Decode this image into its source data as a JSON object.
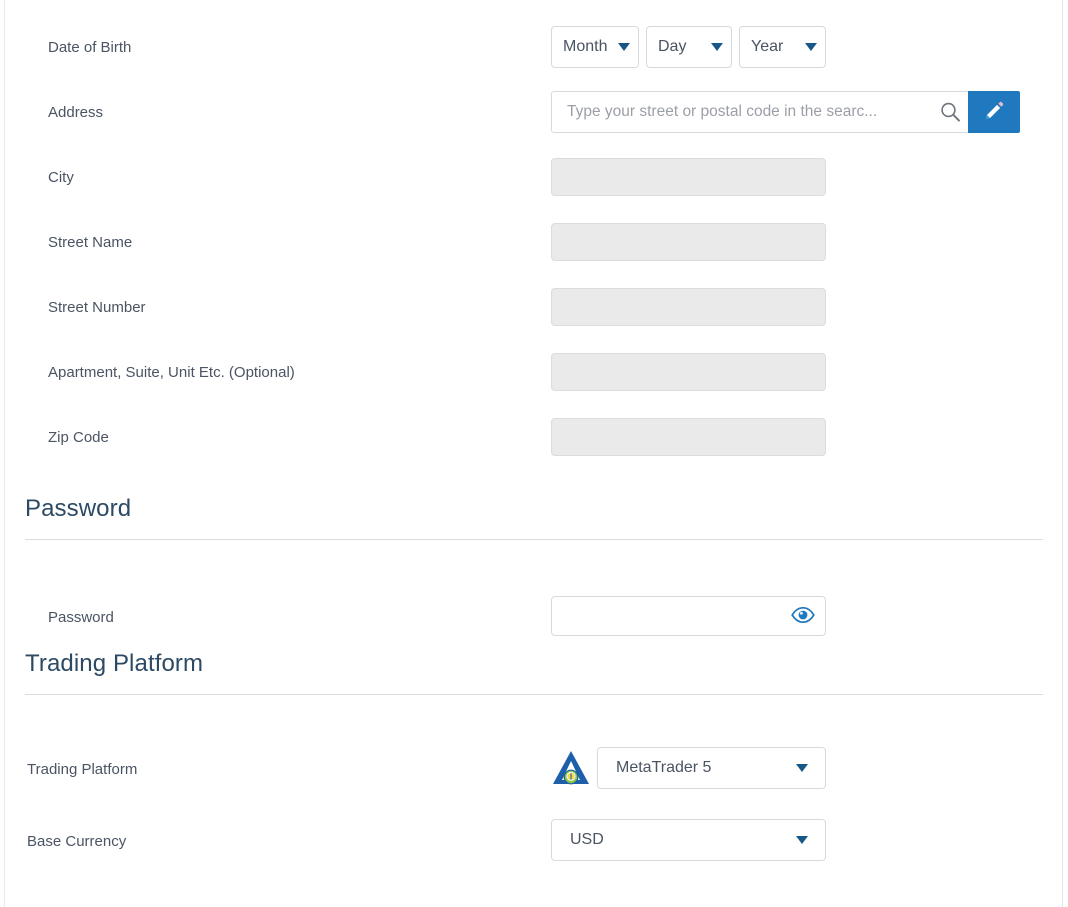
{
  "form": {
    "fields": [
      {
        "label": "Date of Birth",
        "type": "date-selects"
      },
      {
        "label": "Address",
        "type": "address-search"
      },
      {
        "label": "City",
        "type": "disabled-text"
      },
      {
        "label": "Street Name",
        "type": "disabled-text"
      },
      {
        "label": "Street Number",
        "type": "disabled-text"
      },
      {
        "label": "Apartment, Suite, Unit Etc. (Optional)",
        "type": "disabled-text"
      },
      {
        "label": "Zip Code",
        "type": "disabled-text"
      }
    ],
    "date_of_birth": {
      "month": {
        "value": "Month",
        "placeholder": "Month"
      },
      "day": {
        "value": "Day",
        "placeholder": "Day"
      },
      "year": {
        "value": "Year",
        "placeholder": "Year"
      }
    },
    "address": {
      "placeholder": "Type your street or postal code in the searc...",
      "value": "",
      "search_icon": "search-icon",
      "edit_icon": "pencil-icon"
    },
    "city": {
      "value": ""
    },
    "street_name": {
      "value": ""
    },
    "street_number": {
      "value": ""
    },
    "apartment": {
      "value": ""
    },
    "zip_code": {
      "value": ""
    }
  },
  "password_section": {
    "heading": "Password",
    "field_label": "Password",
    "value": "",
    "placeholder": "",
    "toggle_icon": "eye-icon"
  },
  "trading_platform_section": {
    "heading": "Trading Platform",
    "platform_label": "Trading Platform",
    "platform_value": "MetaTrader 5",
    "platform_icon": "metatrader-logo-icon",
    "currency_label": "Base Currency",
    "currency_value": "USD"
  },
  "colors": {
    "accent_blue": "#2079bf",
    "caret_blue": "#165788",
    "heading_blue": "#2c4a63",
    "label_gray": "#4a5463",
    "disabled_field": "#eaeaea",
    "border_gray": "#d7d9dc",
    "rule_gray": "#dcdcdc"
  }
}
